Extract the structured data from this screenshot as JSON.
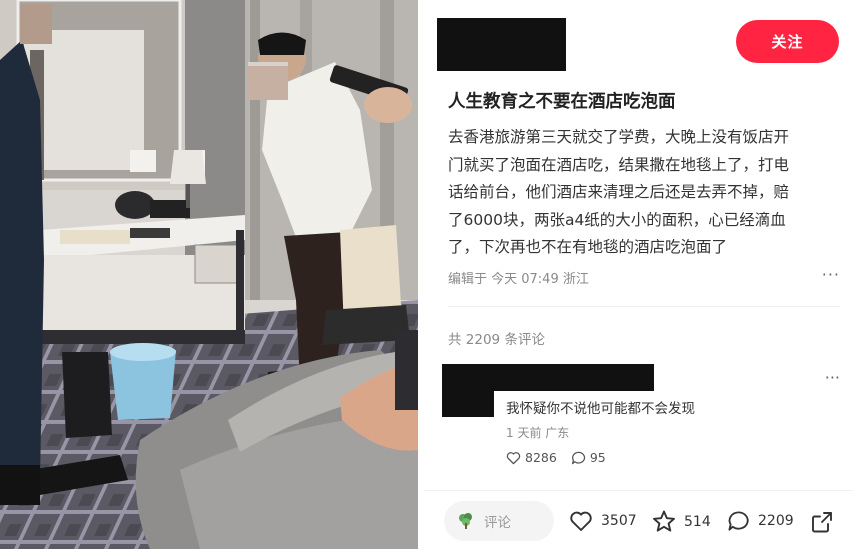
{
  "post": {
    "follow_label": "关注",
    "title": "人生教育之不要在酒店吃泡面",
    "body_lines": [
      "去香港旅游第三天就交了学费，大晚上没有饭店开",
      "门就买了泡面在酒店吃，结果撒在地毯上了，打电",
      "话给前台，他们酒店来清理之后还是去弄不掉，赔",
      "了6000块，两张a4纸的大小的面积，心已经滴血",
      "了，下次再也不在有地毯的酒店吃泡面了"
    ],
    "meta": "编辑于 今天 07:49 浙江",
    "more_label": "···"
  },
  "comments": {
    "count_label": "共 2209 条评论",
    "items": [
      {
        "text": "我怀疑你不说他可能都不会发现",
        "meta": "1 天前  广东",
        "likes": "8286",
        "replies": "95"
      }
    ]
  },
  "bottom_bar": {
    "input_placeholder": "评论",
    "likes": "3507",
    "collects": "514",
    "comments": "2209"
  },
  "colors": {
    "accent": "#ff2442",
    "muted_text": "#8a8a8a",
    "redaction": "#111111"
  },
  "icons": [
    "leaf-avatar-icon",
    "heart-icon",
    "star-icon",
    "chat-bubble-icon",
    "share-icon"
  ]
}
